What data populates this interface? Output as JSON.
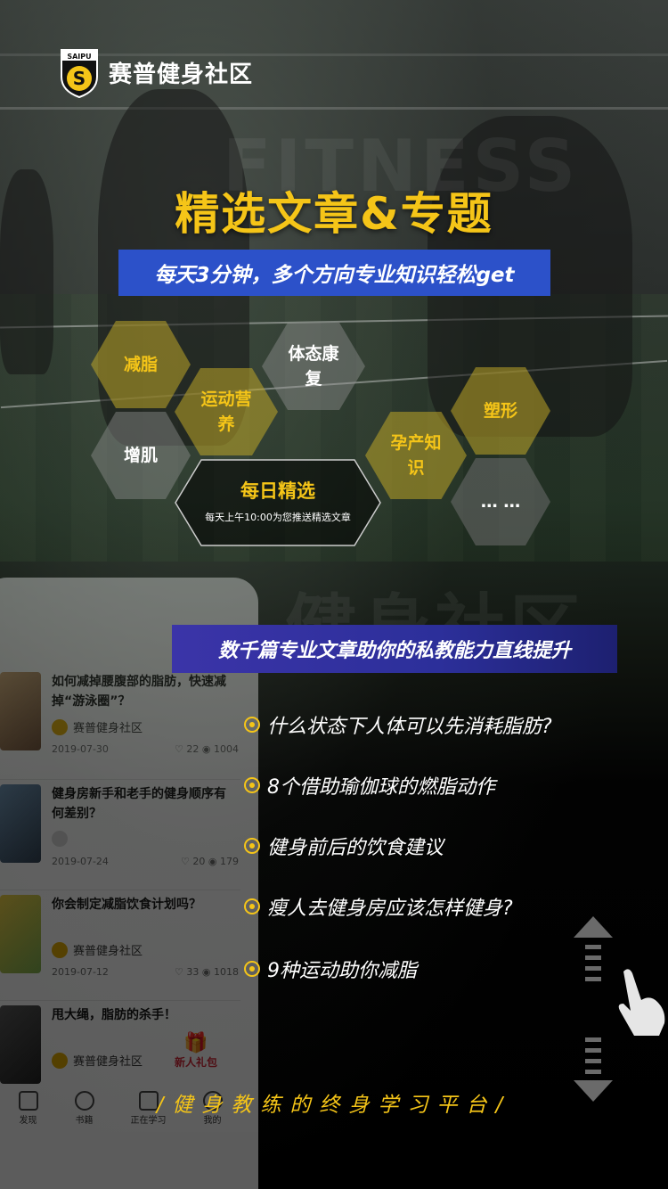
{
  "brand": {
    "logo_badge": "SAIPU",
    "name": "赛普健身社区",
    "accent": "#f5c518",
    "blue": "#2c51c9"
  },
  "watermark_top": "FITNESS",
  "watermark_mid": "健身社区",
  "hero": {
    "title": "精选文章&专题",
    "subtitle": "每天3分钟，多个方向专业知识轻松get"
  },
  "topics": {
    "fat_loss": "减脂",
    "nutrition": "运动营养",
    "posture": "体态康复",
    "muscle": "增肌",
    "pregnancy": "孕产知识",
    "shaping": "塑形",
    "more": "… …",
    "daily": {
      "title": "每日精选",
      "desc": "每天上午10:00为您推送精选文章"
    }
  },
  "phone": {
    "articles": [
      {
        "title": "如何减掉腰腹部的脂肪，快速减掉“游泳圈”？",
        "source": "赛普健身社区",
        "date": "2019-07-30",
        "likes": "22",
        "views": "1004"
      },
      {
        "title": "健身房新手和老手的健身顺序有何差别？",
        "source": "",
        "date": "2019-07-24",
        "likes": "20",
        "views": "179"
      },
      {
        "title": "你会制定减脂饮食计划吗？",
        "source": "赛普健身社区",
        "date": "2019-07-12",
        "likes": "33",
        "views": "1018"
      },
      {
        "title": "甩大绳，脂肪的杀手！",
        "source": "赛普健身社区",
        "date": "",
        "likes": "",
        "views": ""
      }
    ],
    "gift": "新人礼包",
    "tabs": [
      "发现",
      "书籍",
      "正在学习",
      "我的"
    ]
  },
  "banner": "数千篇专业文章助你的私教能力直线提升",
  "bullets": [
    "什么状态下人体可以先消耗脂肪?",
    "8个借助瑜伽球的燃脂动作",
    "健身前后的饮食建议",
    "瘦人去健身房应该怎样健身?",
    "9种运动助你减脂"
  ],
  "footer": "/健身教练的终身学习平台/"
}
